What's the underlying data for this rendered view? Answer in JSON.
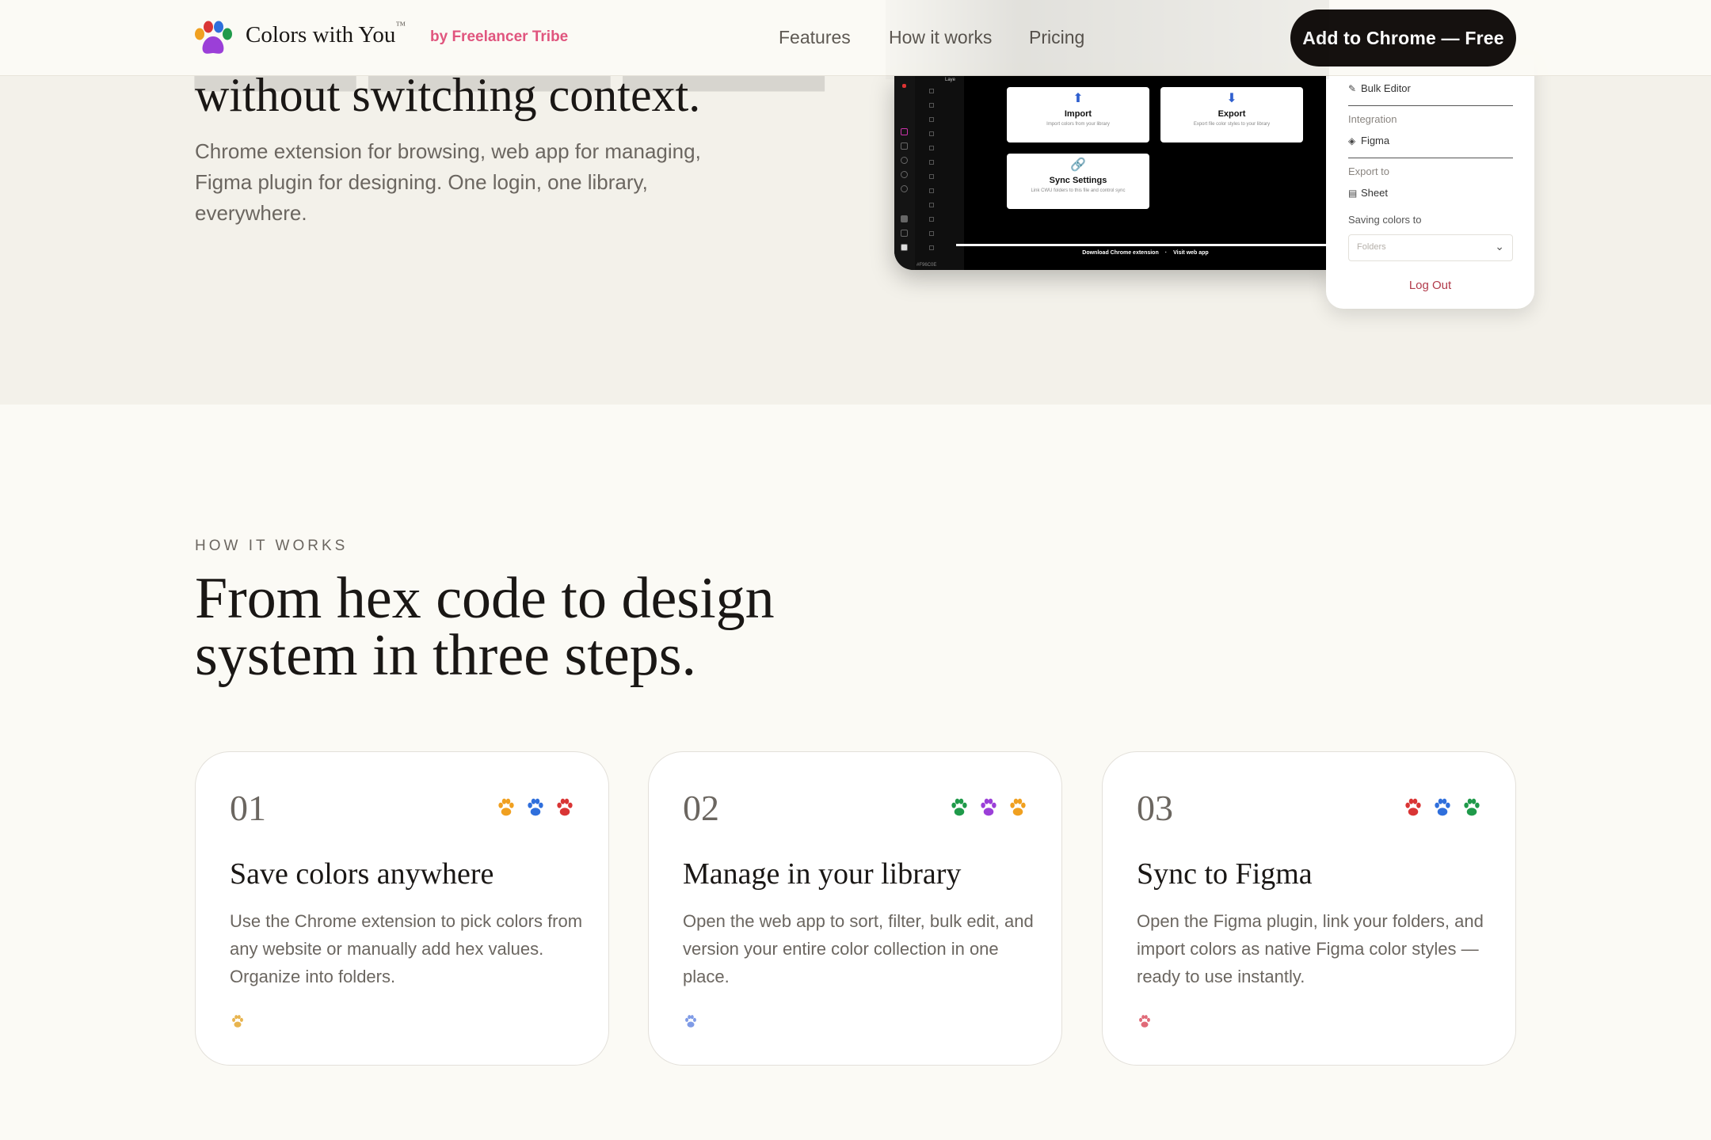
{
  "nav": {
    "brand": "Colors with You",
    "trademark": "™",
    "by_line": "by Freelancer Tribe",
    "links": [
      "Features",
      "How it works",
      "Pricing"
    ],
    "cta": "Add to Chrome — Free"
  },
  "hero": {
    "title_line": "without switching context.",
    "subtitle": "Chrome extension for browsing, web app for managing, Figma plugin for designing. One login, one library, everywhere."
  },
  "mockup": {
    "layers_label": "Laye",
    "hex_code": "#F96C0E",
    "cards": [
      {
        "title": "Import",
        "desc": "Import colors from your library",
        "icon": "import-icon"
      },
      {
        "title": "Export",
        "desc": "Export file color styles to your library",
        "icon": "export-icon"
      },
      {
        "title": "Sync Settings",
        "desc": "Link CWU folders to this file and control sync",
        "icon": "link-icon"
      }
    ],
    "footer_links": [
      "Download Chrome extension",
      "·",
      "Visit web app"
    ]
  },
  "popup": {
    "bulk_editor": "Bulk Editor",
    "integration_label": "Integration",
    "figma": "Figma",
    "export_label": "Export to",
    "sheet": "Sheet",
    "saving_label": "Saving colors to",
    "select_placeholder": "Folders",
    "logout": "Log Out"
  },
  "how_it_works": {
    "eyebrow": "HOW IT WORKS",
    "title": "From hex code to design system in three steps.",
    "steps": [
      {
        "number": "01",
        "title": "Save colors anywhere",
        "description": "Use the Chrome extension to pick colors from any website or manually add hex values. Organize into folders.",
        "paw_colors": [
          "#f0a020",
          "#2f6fdc",
          "#d93535"
        ],
        "mini_paw_color": "#e8b44e"
      },
      {
        "number": "02",
        "title": "Manage in your library",
        "description": "Open the web app to sort, filter, bulk edit, and version your entire color collection in one place.",
        "paw_colors": [
          "#1f9a4a",
          "#9b3fd8",
          "#f0a020"
        ],
        "mini_paw_color": "#7f9be6"
      },
      {
        "number": "03",
        "title": "Sync to Figma",
        "description": "Open the Figma plugin, link your folders, and import colors as native Figma color styles — ready to use instantly.",
        "paw_colors": [
          "#d93535",
          "#2f6fdc",
          "#1f9a4a"
        ],
        "mini_paw_color": "#e06a78"
      }
    ]
  },
  "colors": {
    "background": "#fbfaf5",
    "hero_band": "#f3f1ea",
    "accent_pink": "#e0557e",
    "cta_bg": "#15110f",
    "text": "#1a1715",
    "muted": "#6b6660"
  }
}
